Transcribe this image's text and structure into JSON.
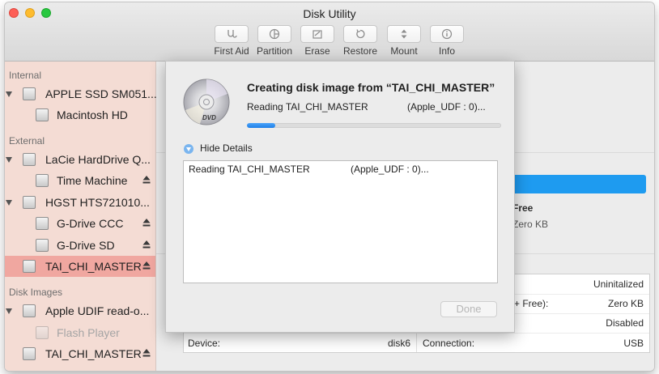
{
  "window": {
    "title": "Disk Utility"
  },
  "toolbar": {
    "buttons": [
      {
        "label": "First Aid",
        "icon": "stethoscope-icon"
      },
      {
        "label": "Partition",
        "icon": "partition-pie-icon"
      },
      {
        "label": "Erase",
        "icon": "erase-icon"
      },
      {
        "label": "Restore",
        "icon": "restore-arrow-icon"
      },
      {
        "label": "Mount",
        "icon": "mount-icon"
      },
      {
        "label": "Info",
        "icon": "info-icon"
      }
    ]
  },
  "sidebar": {
    "sections": [
      {
        "header": "Internal",
        "items": [
          {
            "label": "APPLE SSD SM051...",
            "level": 0,
            "eject": false,
            "selected": false,
            "faded": false
          },
          {
            "label": "Macintosh HD",
            "level": 1,
            "eject": false,
            "selected": false,
            "faded": false
          }
        ]
      },
      {
        "header": "External",
        "items": [
          {
            "label": "LaCie HardDrive Q...",
            "level": 0,
            "eject": false,
            "selected": false,
            "faded": false
          },
          {
            "label": "Time Machine",
            "level": 1,
            "eject": true,
            "selected": false,
            "faded": false
          },
          {
            "label": "HGST HTS721010...",
            "level": 0,
            "eject": false,
            "selected": false,
            "faded": false
          },
          {
            "label": "G-Drive CCC",
            "level": 1,
            "eject": true,
            "selected": false,
            "faded": false
          },
          {
            "label": "G-Drive SD",
            "level": 1,
            "eject": true,
            "selected": false,
            "faded": false
          },
          {
            "label": "TAI_CHI_MASTER",
            "level": 0,
            "eject": true,
            "selected": true,
            "faded": false
          }
        ]
      },
      {
        "header": "Disk Images",
        "items": [
          {
            "label": "Apple UDIF read-o...",
            "level": 0,
            "eject": false,
            "selected": false,
            "faded": false
          },
          {
            "label": "Flash Player",
            "level": 1,
            "eject": false,
            "selected": false,
            "faded": true
          },
          {
            "label": "TAI_CHI_MASTER",
            "level": 0,
            "eject": true,
            "selected": false,
            "faded": false
          }
        ]
      }
    ]
  },
  "main": {
    "free_label": "Free",
    "free_value": "Zero KB",
    "info_rows": [
      {
        "left_label": "",
        "left_value": "",
        "right_label": "",
        "right_value": "Uninitalized"
      },
      {
        "left_label": "",
        "left_value": "",
        "right_label": "+ Free):",
        "right_value": "Zero KB"
      },
      {
        "left_label": "",
        "left_value": "",
        "right_label": "",
        "right_value": "Disabled"
      },
      {
        "left_label": "Device:",
        "left_value": "disk6",
        "right_label": "Connection:",
        "right_value": "USB"
      }
    ]
  },
  "sheet": {
    "icon": "dvd-disc-icon",
    "title": "Creating disk image from “TAI_CHI_MASTER”",
    "status_text": "Reading TAI_CHI_MASTER",
    "status_format": "(Apple_UDF : 0)...",
    "progress_percent": 11,
    "details_toggle_label": "Hide Details",
    "log_lines": [
      {
        "text": "Reading TAI_CHI_MASTER",
        "format": "(Apple_UDF : 0)..."
      }
    ],
    "done_label": "Done"
  },
  "colors": {
    "accent": "#1e9bf0",
    "sidebar_bg": "#f4dcd4",
    "sidebar_selected": "#f0a7a0",
    "progress": "#2f8cf0"
  }
}
